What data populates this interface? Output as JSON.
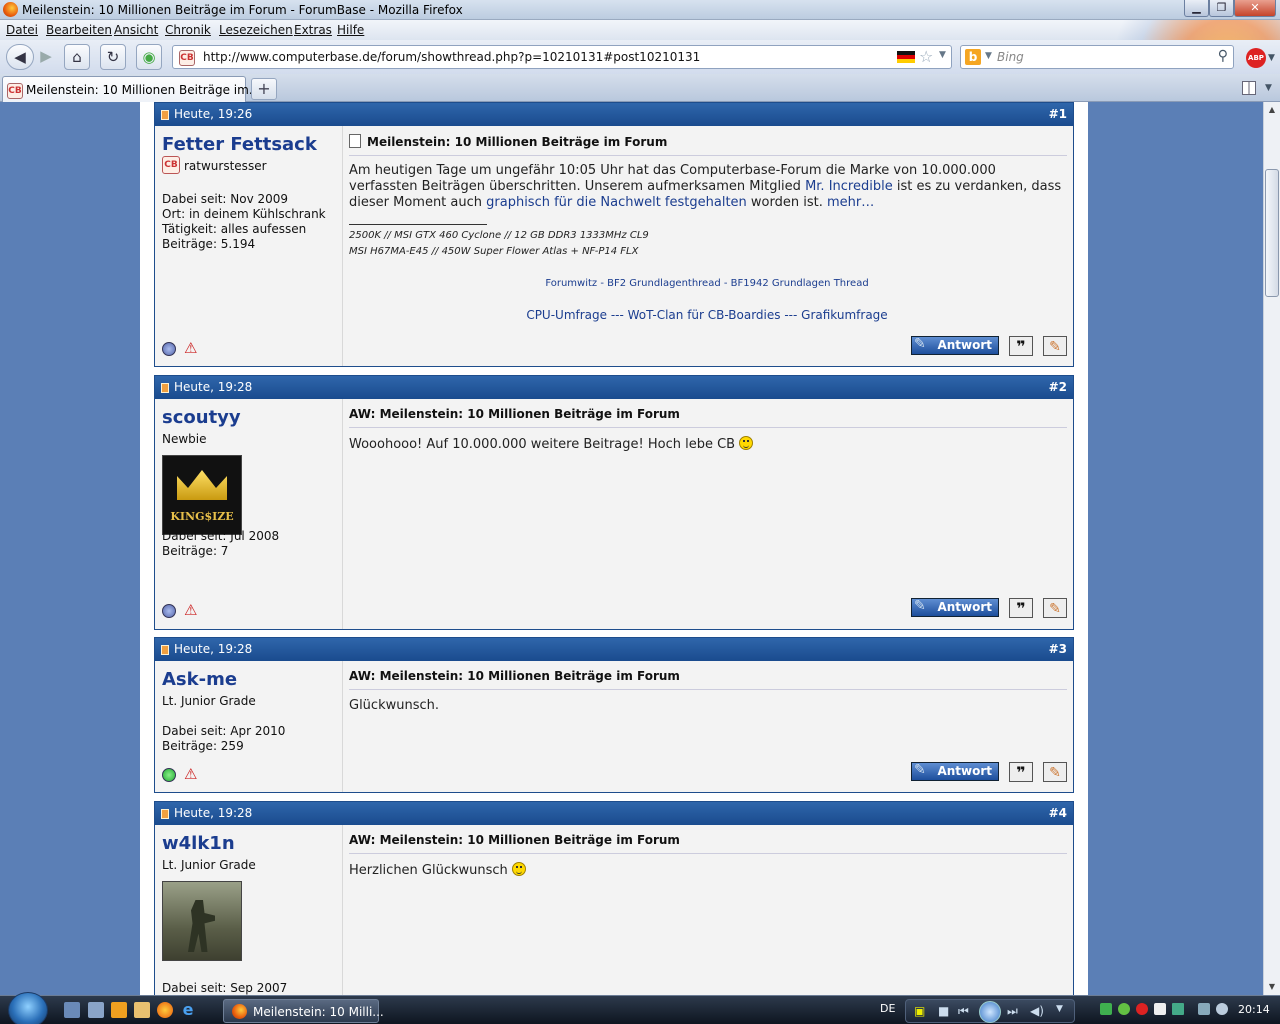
{
  "window": {
    "title": "Meilenstein: 10 Millionen Beiträge im Forum - ForumBase - Mozilla Firefox"
  },
  "menu": [
    "Datei",
    "Bearbeiten",
    "Ansicht",
    "Chronik",
    "Lesezeichen",
    "Extras",
    "Hilfe"
  ],
  "nav": {
    "url": "http://www.computerbase.de/forum/showthread.php?p=10210131#post10210131",
    "search_placeholder": "Bing",
    "favicon_text": "CB",
    "abp_text": "ABP"
  },
  "tabs": [
    {
      "label": "Meilenstein: 10 Millionen Beiträge im..."
    }
  ],
  "icons": {
    "back": "back-arrow-icon",
    "forward": "forward-arrow-icon",
    "home": "home-icon",
    "reload": "reload-icon",
    "webslice": "webslice-icon",
    "bookmark": "star-icon",
    "search": "magnifier-icon"
  },
  "posts": [
    {
      "date": "Heute, 19:26",
      "number": "#1",
      "username": "Fetter Fettsack",
      "rank": "ratwurstesser",
      "info": [
        "Dabei seit: Nov 2009",
        "Ort: in deinem Kühlschrank",
        "Tätigkeit: alles aufessen",
        "Beiträge: 5.194"
      ],
      "title": "Meilenstein: 10 Millionen Beiträge im Forum",
      "text_1": "Am heutigen Tage um ungefähr 10:05 Uhr hat das Computerbase-Forum die Marke von 10.000.000 verfassten Beiträgen überschritten. Unserem aufmerksamen Mitglied ",
      "link_1": "Mr. Incredible",
      "text_2": " ist es zu verdanken, dass dieser Moment auch ",
      "link_2": "graphisch für die Nachwelt festgehalten",
      "text_3": " worden ist. ",
      "link_more": "mehr…",
      "sig_lines": [
        "2500K // MSI GTX 460 Cyclone // 12 GB DDR3 1333MHz CL9",
        "MSI H67MA-E45 // 450W Super Flower Atlas + NF-P14 FLX"
      ],
      "sig_links_small": "Forumwitz - BF2 Grundlagenthread - BF1942 Grundlagen Thread",
      "sig_links_big": "CPU-Umfrage --- WoT-Clan für CB-Boardies --- Grafikumfrage",
      "reply_label": "Antwort"
    },
    {
      "date": "Heute, 19:28",
      "number": "#2",
      "username": "scoutyy",
      "rank": "Newbie",
      "avatar_text": "KING$IZE",
      "info": [
        "Dabei seit: Jul 2008",
        "Beiträge: 7"
      ],
      "title": "AW: Meilenstein: 10 Millionen Beiträge im Forum",
      "text": "Wooohooo! Auf 10.000.000 weitere Beitrage! Hoch lebe CB ",
      "reply_label": "Antwort"
    },
    {
      "date": "Heute, 19:28",
      "number": "#3",
      "username": "Ask-me",
      "rank": "Lt. Junior Grade",
      "info": [
        "Dabei seit: Apr 2010",
        "Beiträge: 259"
      ],
      "title": "AW: Meilenstein: 10 Millionen Beiträge im Forum",
      "text": "Glückwunsch.",
      "reply_label": "Antwort"
    },
    {
      "date": "Heute, 19:28",
      "number": "#4",
      "username": "w4lk1n",
      "rank": "Lt. Junior Grade",
      "info": [
        "Dabei seit: Sep 2007"
      ],
      "title": "AW: Meilenstein: 10 Millionen Beiträge im Forum",
      "text": "Herzlichen Glückwunsch "
    }
  ],
  "taskbar": {
    "task_label": "Meilenstein: 10 Milli...",
    "lang": "DE",
    "clock": "20:14"
  },
  "colors": {
    "post_header": "#1a4b8e",
    "username": "#1b3d8f",
    "link": "#1b3d8f",
    "online": "#22aa33",
    "offline": "#5566aa"
  }
}
